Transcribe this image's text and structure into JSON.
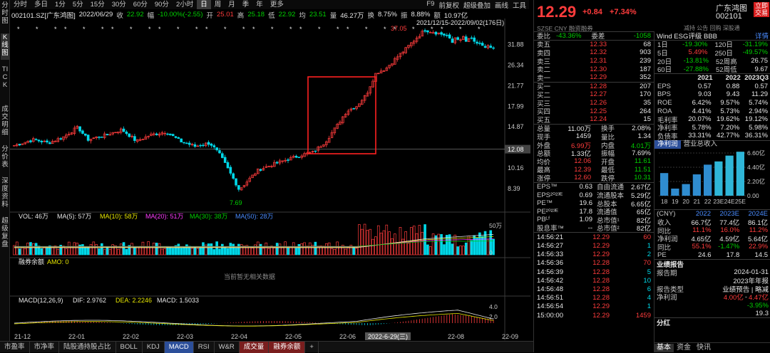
{
  "timeframes": [
    "分时",
    "多日",
    "1分",
    "5分",
    "15分",
    "30分",
    "60分",
    "90分",
    "2小时",
    "日",
    "周",
    "月",
    "季",
    "年",
    "更多"
  ],
  "active_tf": "日",
  "toolbar_right": [
    "F9",
    "前复权",
    "超级叠加",
    "画线",
    "工具"
  ],
  "side_tabs": [
    {
      "t": "分时图",
      "on": false
    },
    {
      "t": "K线图",
      "on": true
    },
    {
      "t": "TICK",
      "on": false
    },
    {
      "t": "成交明细",
      "on": false
    },
    {
      "t": "分价表",
      "on": false
    },
    {
      "t": "深度资料",
      "on": false
    },
    {
      "t": "超级复盘",
      "on": false
    }
  ],
  "info": {
    "code": "002101.SZ[广东鸿图]",
    "date": "2022/06/29",
    "close_label": "收",
    "close": "22.92",
    "change_label": "幅",
    "change": "-10.00%(-2.55)",
    "open_label": "开",
    "open": "25.01",
    "high_label": "高",
    "high": "25.18",
    "low_label": "低",
    "low": "22.92",
    "prev_label": "均",
    "prev": "23.51",
    "vol_label": "量",
    "vol": "46.27万",
    "turn_label": "换",
    "turn": "8.75%",
    "amp_label": "振",
    "amp": "8.88%",
    "amt_label": "额",
    "amt": "10.97亿"
  },
  "range_label": "2021/12/15-2022/09/02(176日)",
  "price_axis": [
    "31.88",
    "26.34",
    "21.77",
    "17.99",
    "14.87",
    "12.08",
    "10.16",
    "8.39"
  ],
  "current_price_tag": "12.08",
  "hi_label": "37.05",
  "lo_label": "7.69",
  "vol_info": {
    "label": "VOL: 46万",
    "ma5": "MA(5): 57万",
    "ma10": "MA(10): 58万",
    "ma20": "MA(20): 51万",
    "ma30": "MA(30): 38万",
    "ma50": "MA(50): 28万"
  },
  "vol_axis": [
    "50万",
    "0"
  ],
  "margin_label": "融券余额",
  "margin_amo": "AMO: 0",
  "no_data": "当前暂无相关数据",
  "macd_info": {
    "label": "MACD(12,26,9)",
    "dif": "DIF: 2.9762",
    "dea": "DEA: 2.2246",
    "macd": "MACD: 1.5033"
  },
  "macd_axis": [
    "4.0",
    "2.0"
  ],
  "dates": [
    "21-12",
    "22-01",
    "22-02",
    "22-03",
    "22-04",
    "22-05",
    "22-06",
    "22-07",
    "22-08",
    "22-09"
  ],
  "date_highlight": "2022-6-29(三)",
  "bottom_tabs": [
    {
      "t": "市盈率",
      "c": ""
    },
    {
      "t": "市净率",
      "c": ""
    },
    {
      "t": "陆股通持股占比",
      "c": ""
    },
    {
      "t": "BOLL",
      "c": ""
    },
    {
      "t": "KDJ",
      "c": ""
    },
    {
      "t": "MACD",
      "c": "on"
    },
    {
      "t": "RSI",
      "c": ""
    },
    {
      "t": "W&R",
      "c": ""
    },
    {
      "t": "成交量",
      "c": "hl"
    },
    {
      "t": "融券余额",
      "c": "hl"
    },
    {
      "t": "+",
      "c": ""
    }
  ],
  "quote": {
    "price": "12.29",
    "chg": "+0.84",
    "pct": "+7.34%",
    "name": "广东鸿图",
    "code": "002101",
    "buy_btn": "立即交易",
    "exch": "SZSE",
    "cur": "CNY",
    "sub": "融资融券",
    "tags": "减持 公告 回购 深股通",
    "wei_bi_label": "委比",
    "wei_bi": "-43.36%",
    "wei_cha_label": "委差",
    "wei_cha": "-1058"
  },
  "asks": [
    [
      "卖五",
      "12.33",
      "68"
    ],
    [
      "卖四",
      "12.32",
      "903"
    ],
    [
      "卖三",
      "12.31",
      "239"
    ],
    [
      "卖二",
      "12.30",
      "187"
    ],
    [
      "卖一",
      "12.29",
      "352"
    ]
  ],
  "bids": [
    [
      "买一",
      "12.28",
      "207"
    ],
    [
      "买二",
      "12.27",
      "170"
    ],
    [
      "买三",
      "12.26",
      "35"
    ],
    [
      "买四",
      "12.25",
      "264"
    ],
    [
      "买五",
      "12.24",
      "15"
    ]
  ],
  "stats": [
    [
      "总量",
      "11.00万",
      "换手",
      "2.08%"
    ],
    [
      "现手",
      "1459",
      "量比",
      "1.34"
    ],
    [
      "外盘",
      "6.99万",
      "内盘",
      "4.01万"
    ],
    [
      "总额",
      "1.33亿",
      "振幅",
      "7.69%"
    ],
    [
      "均价",
      "12.06",
      "开盘",
      "11.61"
    ],
    [
      "最高",
      "12.39",
      "最低",
      "11.51"
    ],
    [
      "涨停",
      "12.60",
      "跌停",
      "10.31"
    ]
  ],
  "fin1": [
    [
      "EPS™",
      "0.63",
      "自由流通",
      "2.67亿"
    ],
    [
      "EPS²⁰²³ᴱ",
      "0.69",
      "流通股本",
      "5.29亿"
    ],
    [
      "PE™",
      "19.6",
      "总股本",
      "6.65亿"
    ],
    [
      "PE²⁰²³ᴱ",
      "17.8",
      "流通值",
      "65亿"
    ],
    [
      "PBᴸᶠ",
      "1.09",
      "总市值¹",
      "82亿"
    ],
    [
      "股息率™",
      "--",
      "总市值²",
      "82亿"
    ]
  ],
  "ticks": [
    [
      "14:56:21",
      "12.29",
      "60"
    ],
    [
      "14:56:27",
      "12.29",
      "1"
    ],
    [
      "14:56:33",
      "12.29",
      "2"
    ],
    [
      "14:56:36",
      "12.28",
      "70"
    ],
    [
      "14:56:39",
      "12.28",
      "5"
    ],
    [
      "14:56:42",
      "12.28",
      "10"
    ],
    [
      "14:56:48",
      "12.28",
      "6"
    ],
    [
      "14:56:51",
      "12.28",
      "4"
    ],
    [
      "14:56:54",
      "12.29",
      "1"
    ],
    [
      "15:00:00",
      "12.29",
      "1459"
    ]
  ],
  "perf": {
    "wind_esg": "Wind ESG评级 BBB",
    "detail": "详情",
    "rows": [
      [
        "1日",
        "-19.30%",
        "120日",
        "-31.19%"
      ],
      [
        "5日",
        "5.49%",
        "250日",
        "-49.57%"
      ],
      [
        "20日",
        "-13.81%",
        "52周高",
        "26.75"
      ],
      [
        "60日",
        "-27.88%",
        "52周低",
        "9.67"
      ]
    ]
  },
  "annual": {
    "cols": [
      "2021",
      "2022",
      "2023Q3"
    ],
    "rows": [
      [
        "EPS",
        "0.57",
        "0.88",
        "0.57"
      ],
      [
        "BPS",
        "9.03",
        "9.43",
        "11.29"
      ],
      [
        "ROE",
        "6.42%",
        "9.57%",
        "5.74%"
      ],
      [
        "ROA",
        "4.41%",
        "5.73%",
        "2.94%"
      ],
      [
        "毛利率",
        "20.07%",
        "19.62%",
        "19.12%"
      ],
      [
        "净利率",
        "5.78%",
        "7.20%",
        "5.98%"
      ],
      [
        "负债率",
        "33.31%",
        "42.77%",
        "36.31%"
      ]
    ]
  },
  "rev_tabs": [
    "净利润",
    "营业总收入"
  ],
  "rev_axis": [
    "6.60亿",
    "4.40亿",
    "2.20亿",
    "0.00"
  ],
  "rev_years": [
    "18",
    "19",
    "20",
    "21",
    "22",
    "23E",
    "24E",
    "25E"
  ],
  "rev_values": [
    3.5,
    1.1,
    1.8,
    3.3,
    4.8,
    5.3,
    6.2,
    6.8
  ],
  "forecast": {
    "cols": [
      "2022",
      "2023E",
      "2024E"
    ],
    "rows": [
      [
        "收入",
        "66.7亿",
        "77.4亿",
        "86.1亿"
      ],
      [
        "同比",
        "11.1%",
        "16.0%",
        "11.2%"
      ],
      [
        "净利润",
        "4.65亿",
        "4.59亿",
        "5.64亿"
      ],
      [
        "同比",
        "55.1%",
        "-1.47%",
        "22.9%"
      ],
      [
        "PE",
        "24.6",
        "17.8",
        "14.5"
      ]
    ]
  },
  "report": {
    "title": "业绩报告",
    "date_label": "报告期",
    "date": "2024-01-31",
    "year_label": "",
    "year": "2023年年报",
    "type_label": "报告类型",
    "type": "业绩预告 | 略减",
    "np_label": "净利润",
    "np1": "4.00亿",
    "np2": "4.47亿",
    "yoy": "-3.95%",
    "pe": "19.3"
  },
  "fenhong": "分红",
  "rtabs": [
    "基本",
    "资金",
    "快讯"
  ],
  "colors": {
    "up": "#ff3c3c",
    "down": "#00d8e8",
    "ma5": "#e6e6e6",
    "ma10": "#e8e800",
    "ma20": "#ff3cff",
    "ma30": "#00d000",
    "ma50": "#4a8cff"
  }
}
